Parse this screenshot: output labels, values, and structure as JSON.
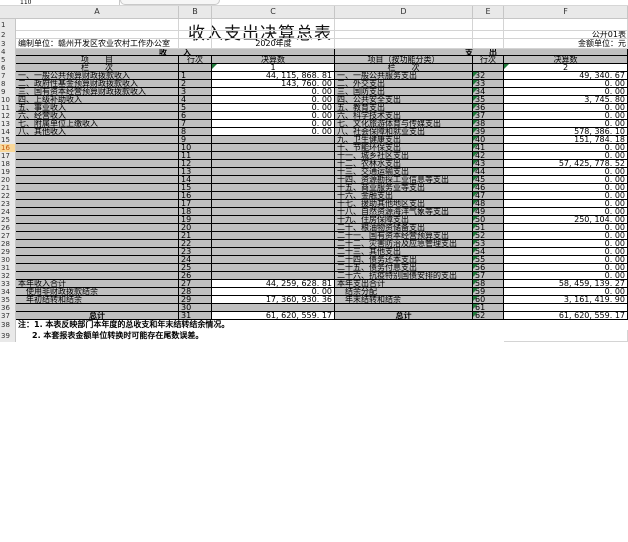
{
  "name_box": "110",
  "columns": [
    "A",
    "B",
    "C",
    "D",
    "E",
    "F"
  ],
  "row_numbers": [
    "1",
    "2",
    "3",
    "4",
    "5",
    "6",
    "7",
    "8",
    "9",
    "10",
    "11",
    "12",
    "13",
    "14",
    "15",
    "16",
    "17",
    "18",
    "19",
    "20",
    "21",
    "22",
    "23",
    "24",
    "25",
    "26",
    "27",
    "28",
    "29",
    "30",
    "31",
    "32",
    "33",
    "34",
    "35",
    "36",
    "37",
    "38",
    "39"
  ],
  "selected_row": "16",
  "title": "收入支出决算总表",
  "form_no": "公开01表",
  "unit_label": "编制单位：赣州开发区农业农村工作办公室",
  "year": "2020年度",
  "amount_unit": "金额单位：元",
  "income_header": "收　　入",
  "expense_header": "支　　出",
  "head_item": "项　　目",
  "head_row": "行次",
  "head_amount": "决算数",
  "head_exp_item": "项目（按功能分类）",
  "head_col": "栏　　次",
  "col_1": "1",
  "col_2": "2",
  "rows": [
    {
      "a": "一、一般公共预算财政拨款收入",
      "b": "1",
      "c": "44, 115, 868. 81",
      "d": "一、一般公共服务支出",
      "e": "32",
      "f": "49, 340. 67"
    },
    {
      "a": "二、政府性基金预算财政拨款收入",
      "b": "2",
      "c": "143, 760. 00",
      "d": "二、外交支出",
      "e": "33",
      "f": "0. 00"
    },
    {
      "a": "三、国有资本经营预算财政拨款收入",
      "b": "3",
      "c": "0. 00",
      "d": "三、国防支出",
      "e": "34",
      "f": "0. 00"
    },
    {
      "a": "四、上级补助收入",
      "b": "4",
      "c": "0. 00",
      "d": "四、公共安全支出",
      "e": "35",
      "f": "3, 745. 80"
    },
    {
      "a": "五、事业收入",
      "b": "5",
      "c": "0. 00",
      "d": "五、教育支出",
      "e": "36",
      "f": "0. 00"
    },
    {
      "a": "六、经营收入",
      "b": "6",
      "c": "0. 00",
      "d": "六、科学技术支出",
      "e": "37",
      "f": "0. 00"
    },
    {
      "a": "七、附属单位上缴收入",
      "b": "7",
      "c": "0. 00",
      "d": "七、文化旅游体育与传媒支出",
      "e": "38",
      "f": "0. 00"
    },
    {
      "a": "八、其他收入",
      "b": "8",
      "c": "0. 00",
      "d": "八、社会保障和就业支出",
      "e": "39",
      "f": "578, 386. 10"
    },
    {
      "a": "",
      "b": "9",
      "c": "",
      "d": "九、卫生健康支出",
      "e": "40",
      "f": "151, 784. 18"
    },
    {
      "a": "",
      "b": "10",
      "c": "",
      "d": "十、节能环保支出",
      "e": "41",
      "f": "0. 00"
    },
    {
      "a": "",
      "b": "11",
      "c": "",
      "d": "十一、城乡社区支出",
      "e": "42",
      "f": "0. 00"
    },
    {
      "a": "",
      "b": "12",
      "c": "",
      "d": "十二、农林水支出",
      "e": "43",
      "f": "57, 425, 778. 52"
    },
    {
      "a": "",
      "b": "13",
      "c": "",
      "d": "十三、交通运输支出",
      "e": "44",
      "f": "0. 00"
    },
    {
      "a": "",
      "b": "14",
      "c": "",
      "d": "十四、资源勘探工业信息等支出",
      "e": "45",
      "f": "0. 00"
    },
    {
      "a": "",
      "b": "15",
      "c": "",
      "d": "十五、商业服务业等支出",
      "e": "46",
      "f": "0. 00"
    },
    {
      "a": "",
      "b": "16",
      "c": "",
      "d": "十六、金融支出",
      "e": "47",
      "f": "0. 00"
    },
    {
      "a": "",
      "b": "17",
      "c": "",
      "d": "十七、援助其他地区支出",
      "e": "48",
      "f": "0. 00"
    },
    {
      "a": "",
      "b": "18",
      "c": "",
      "d": "十八、自然资源海洋气象等支出",
      "e": "49",
      "f": "0. 00"
    },
    {
      "a": "",
      "b": "19",
      "c": "",
      "d": "十九、住房保障支出",
      "e": "50",
      "f": "250, 104. 00"
    },
    {
      "a": "",
      "b": "20",
      "c": "",
      "d": "二十、粮油物资储备支出",
      "e": "51",
      "f": "0. 00"
    },
    {
      "a": "",
      "b": "21",
      "c": "",
      "d": "二十一、国有资本经营预算支出",
      "e": "52",
      "f": "0. 00"
    },
    {
      "a": "",
      "b": "22",
      "c": "",
      "d": "二十二、灾害防治及应急管理支出",
      "e": "53",
      "f": "0. 00"
    },
    {
      "a": "",
      "b": "23",
      "c": "",
      "d": "二十三、其他支出",
      "e": "54",
      "f": "0. 00"
    },
    {
      "a": "",
      "b": "24",
      "c": "",
      "d": "二十四、债务还本支出",
      "e": "55",
      "f": "0. 00"
    },
    {
      "a": "",
      "b": "25",
      "c": "",
      "d": "二十五、债务付息支出",
      "e": "56",
      "f": "0. 00"
    },
    {
      "a": "",
      "b": "26",
      "c": "",
      "d": "二十六、抗疫特别国债安排的支出",
      "e": "57",
      "f": "0. 00"
    },
    {
      "a": "本年收入合计",
      "b": "27",
      "c": "44, 259, 628. 81",
      "d": "本年支出合计",
      "e": "58",
      "f": "58, 459, 139. 27"
    },
    {
      "a": "　使用非财政拨款结余",
      "b": "28",
      "c": "0. 00",
      "d": "　结余分配",
      "e": "59",
      "f": "0. 00"
    },
    {
      "a": "　年初结转和结余",
      "b": "29",
      "c": "17, 360, 930. 36",
      "d": "　年末结转和结余",
      "e": "60",
      "f": "3, 161, 419. 90"
    },
    {
      "a": "",
      "b": "30",
      "c": "",
      "d": "",
      "e": "61",
      "f": ""
    },
    {
      "a": "总计",
      "b": "31",
      "c": "61, 620, 559. 17",
      "d": "总计",
      "e": "62",
      "f": "61, 620, 559. 17"
    }
  ],
  "note1": "注：1. 本表反映部门本年度的总收支和年末结转结余情况。",
  "note2": "2. 本套报表金额单位转换时可能存在尾数误差。"
}
